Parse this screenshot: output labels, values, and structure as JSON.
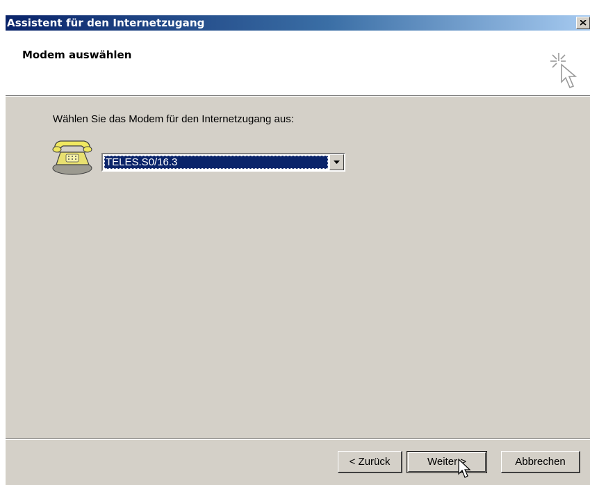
{
  "window": {
    "title": "Assistent für den Internetzugang"
  },
  "header": {
    "title": "Modem auswählen"
  },
  "main": {
    "prompt": "Wählen Sie das Modem für den Internetzugang aus:",
    "modem_select": {
      "selected_value": "TELES.S0/16.3"
    }
  },
  "footer": {
    "back_label": "< Zurück",
    "next_label": "Weiter >",
    "cancel_label": "Abbrechen"
  },
  "colors": {
    "titlebar_start": "#0a246a",
    "titlebar_end": "#a6caf0",
    "dialog_face": "#d4d0c8",
    "selection": "#0a246a"
  },
  "icons": {
    "close": "close-icon",
    "wizard": "wizard-sparkle-cursor-icon",
    "phone": "telephone-modem-icon",
    "dropdown": "chevron-down-icon",
    "cursor": "mouse-pointer-icon"
  }
}
